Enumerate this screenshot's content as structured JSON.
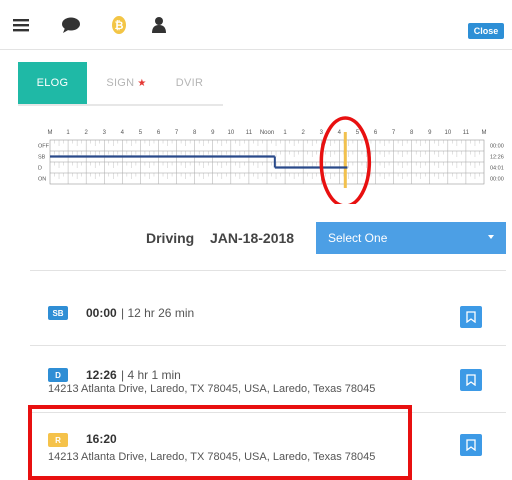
{
  "topbar": {
    "icons": [
      "menu-icon",
      "chat-icon",
      "bitcoin-icon",
      "user-icon"
    ],
    "close_label": "Close"
  },
  "tabs": [
    {
      "label": "ELOG",
      "active": true
    },
    {
      "label": "SIGN",
      "marker": "★"
    },
    {
      "label": "DVIR"
    }
  ],
  "chart": {
    "hour_labels": [
      "M",
      "1",
      "2",
      "3",
      "4",
      "5",
      "6",
      "7",
      "8",
      "9",
      "10",
      "11",
      "Noon",
      "1",
      "2",
      "3",
      "4",
      "5",
      "6",
      "7",
      "8",
      "9",
      "10",
      "11",
      "M"
    ],
    "row_labels": [
      "OFF",
      "SB",
      "D",
      "ON"
    ],
    "totals": [
      "00:00",
      "12:26",
      "04:01",
      "00:00"
    ],
    "current_hour_marker": 16.33,
    "line_color": "#2a4a8a",
    "marker_color": "#f2c14e",
    "circle_color": "#e81010"
  },
  "chart_data": {
    "type": "line",
    "segments": [
      {
        "status": "SB",
        "start": "00:00",
        "end": "12:26"
      },
      {
        "status": "D",
        "start": "12:26",
        "end": "16:27"
      }
    ]
  },
  "status": {
    "label": "Driving",
    "date": "JAN-18-2018",
    "select_placeholder": "Select One"
  },
  "logs": [
    {
      "badge": "SB",
      "badge_color": "#2f8ed5",
      "time": "00:00",
      "duration": "| 12 hr 26 min",
      "address": ""
    },
    {
      "badge": "D",
      "badge_color": "#2f8ed5",
      "time": "12:26",
      "duration": "| 4 hr 1 min",
      "address": "14213 Atlanta Drive, Laredo, TX 78045, USA, Laredo, Texas 78045"
    },
    {
      "badge": "R",
      "badge_color": "#f5c24a",
      "time": "16:20",
      "duration": "",
      "address": "14213 Atlanta Drive, Laredo, TX 78045, USA, Laredo, Texas 78045"
    }
  ]
}
